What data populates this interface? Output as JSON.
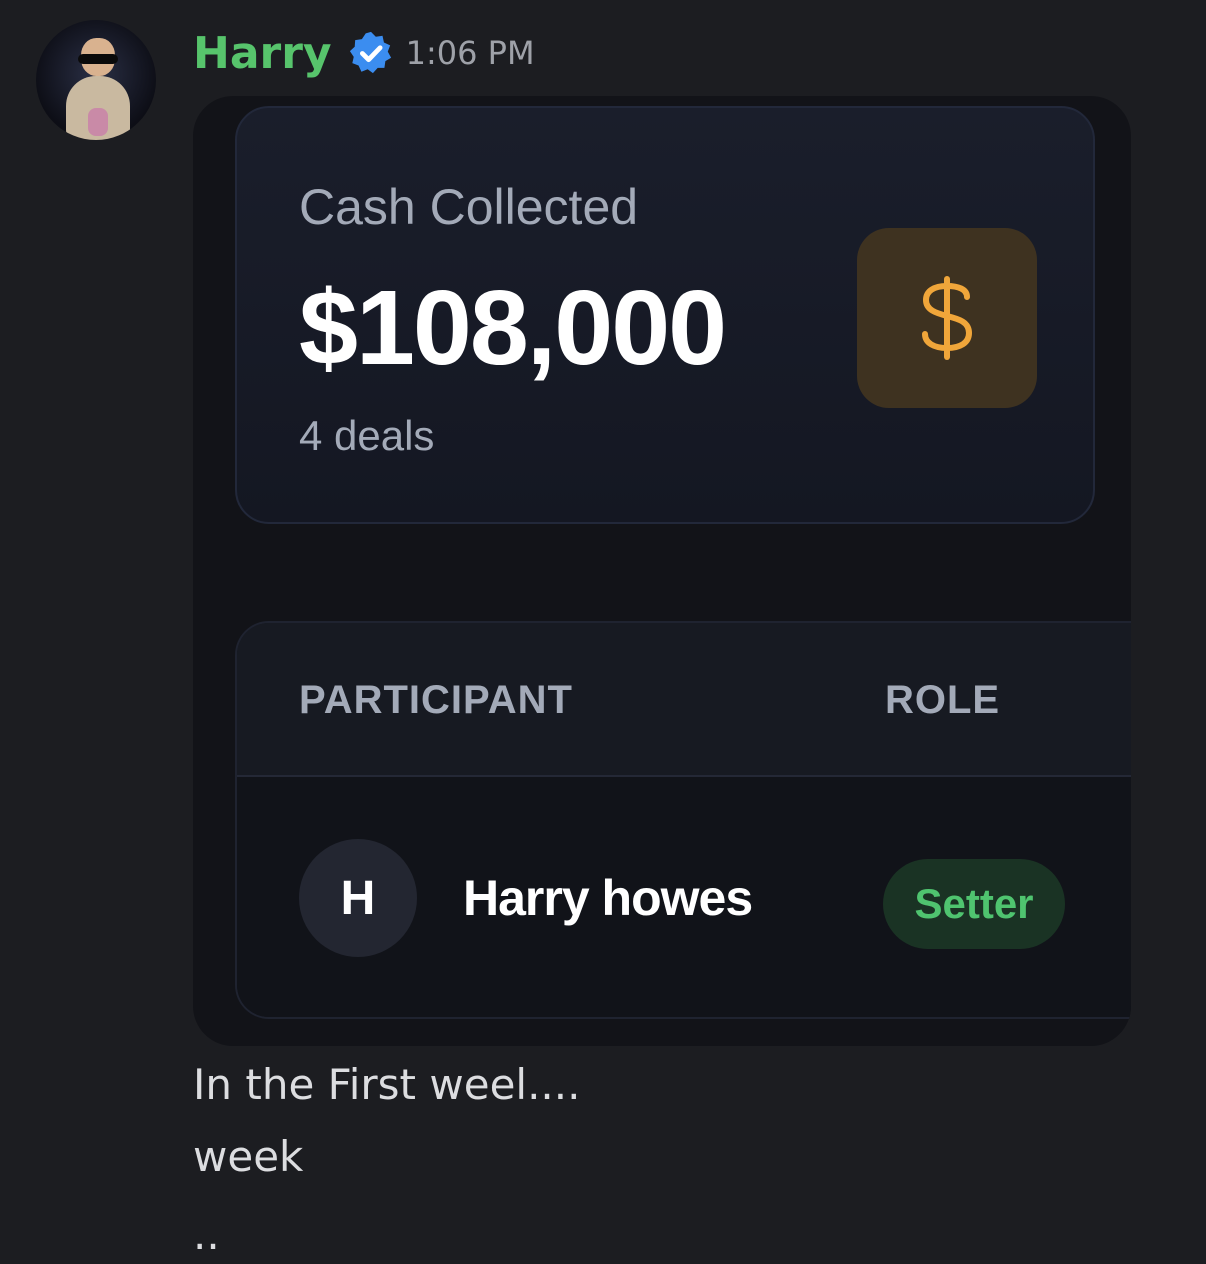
{
  "message": {
    "author": "Harry",
    "timestamp": "1:06 PM",
    "badge_icon": "verified-badge-icon",
    "lines": [
      "In the First weel....",
      "week",
      ".."
    ]
  },
  "embed": {
    "stat_card": {
      "label": "Cash Collected",
      "value": "$108,000",
      "subtext": "4 deals",
      "icon": "dollar-sign-icon",
      "icon_color": "#f0a63a"
    },
    "table": {
      "columns": [
        "PARTICIPANT",
        "ROLE"
      ],
      "rows": [
        {
          "initial": "H",
          "name": "Harry howes",
          "role": "Setter"
        }
      ]
    }
  },
  "colors": {
    "username": "#57c46c",
    "verified": "#3b8df0",
    "role_badge_bg": "#1a3324",
    "role_badge_text": "#4fc46f"
  }
}
